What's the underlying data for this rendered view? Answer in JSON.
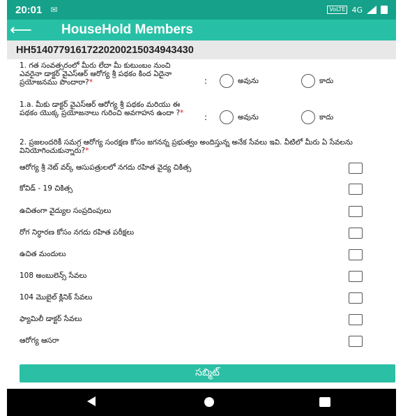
{
  "status_bar": {
    "time": "20:01",
    "notification_icon": "message-icon",
    "network_label": "4G",
    "icons": [
      "signal-icon",
      "battery-icon"
    ]
  },
  "app_bar": {
    "back_icon": "arrow-left-icon",
    "back_glyph": "⟵",
    "title": "HouseHold Members"
  },
  "household_id": "HH5140779161722020021503494343​0",
  "questions": {
    "q1": {
      "text": "1. గత సంవత్సరంలో మీరు లేదా మీ కుటుంబం నుంచి ఎవరైనా డాక్టర్ వైఎస్ఆర్ ఆరోగ్య శ్రీ పథకం కింద ఏదైనా ప్రయోజనము పొందారా?",
      "required_mark": "*",
      "colon": ":",
      "options": [
        "అవును",
        "కాదు"
      ]
    },
    "q1a": {
      "text": "1.a. మీకు డాక్టర్ వైఎస్ఆర్ ఆరోగ్య శ్రీ పథకం మరియు ఈ పథకం యొక్క ప్రయోజనాలు గురించి అవగాహన ఉందా ?",
      "required_mark": "*",
      "colon": ":",
      "options": [
        "అవును",
        "కాదు"
      ]
    },
    "q2": {
      "text": "2. ప్రజలందరికీ సమగ్ర ఆరోగ్య సంరక్షణ కోసం జగనన్న ప్రభుత్వం అందిస్తున్న అనేక సేవలు ఇవి. వీటిలో మీరు ఏ సేవలను వినియోగించుకున్నారు?",
      "required_mark": "*",
      "services": [
        "ఆరోగ్య శ్రీ నెట్ వర్క్ ఆసుపత్రులలో నగదు రహిత వైద్య చికిత్స",
        "కోవిడ్ - 19 చికిత్స",
        "ఉచితంగా వైద్యుల సంప్రదింపులు",
        "రోగ నిర్ధారణ కోసం నగదు రహిత పరీక్షలు",
        "ఉచిత మందులు",
        "108 అంబులెన్స్ సేవలు",
        "104 మొబైల్ క్లినిక్ సేవలు",
        "ఫ్యామిలీ డాక్టర్ సేవలు",
        "ఆరోగ్య ఆసరా"
      ]
    }
  },
  "submit_label": "సబ్మిట్",
  "nav": {
    "icons": [
      "nav-back-icon",
      "nav-home-icon",
      "nav-recent-icon"
    ]
  },
  "colors": {
    "status_bar": "#15a18a",
    "app_bar": "#27c0a6",
    "submit": "#2bbfa5",
    "required": "#e11111"
  }
}
